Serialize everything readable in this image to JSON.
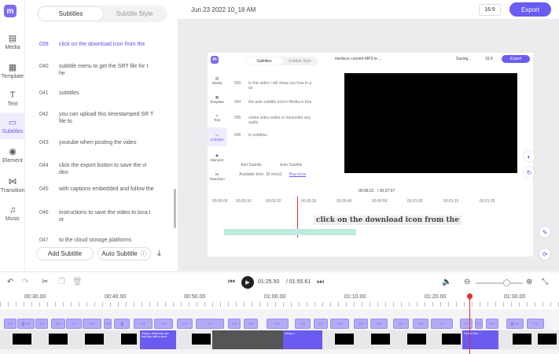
{
  "nav": {
    "items": [
      {
        "label": "Media",
        "icon": "folder-icon"
      },
      {
        "label": "Template",
        "icon": "grid-icon"
      },
      {
        "label": "Text",
        "icon": "text-icon"
      },
      {
        "label": "Subtitles",
        "icon": "subtitles-icon"
      },
      {
        "label": "Element",
        "icon": "element-icon"
      },
      {
        "label": "Transition",
        "icon": "transition-icon"
      },
      {
        "label": "Music",
        "icon": "music-icon"
      }
    ]
  },
  "subtitles_panel": {
    "tabs": [
      "Subtitles",
      "Subtitle Style"
    ],
    "rows": [
      {
        "num": "039",
        "text": "click on the download icon from the"
      },
      {
        "num": "040",
        "text": "subtitle menu to get the SRT file for t he"
      },
      {
        "num": "041",
        "text": "subtitles"
      },
      {
        "num": "042",
        "text": "you can upload this timestamped SR T file to"
      },
      {
        "num": "043",
        "text": "youtube when posting the video"
      },
      {
        "num": "044",
        "text": "click the export button to save the vi deo"
      },
      {
        "num": "045",
        "text": "with captions embedded and follow the"
      },
      {
        "num": "046",
        "text": "instructions to save the video to loca l or"
      },
      {
        "num": "047",
        "text": "to the cloud storage platforms"
      }
    ],
    "add_subtitle": "Add Subtitle",
    "auto_subtitle": "Auto Subtitle"
  },
  "topbar": {
    "title": "Jun 23 2022 10_18 AM",
    "ratio": "16:9",
    "export": "Export"
  },
  "inner": {
    "tabs": [
      "Subtitles",
      "Subtitle Style"
    ],
    "title": "media.io convert MP3 to ...",
    "saving": "Saving...",
    "ratio": "16:9",
    "export": "Export",
    "nav": [
      "Media",
      "Template",
      "Text",
      "Subtitles",
      "Element",
      "Transition"
    ],
    "rows": [
      {
        "num": "003",
        "text": "to this video i will show you how to p as"
      },
      {
        "num": "004",
        "text": "the auto subtitle tool in Media.io thre"
      },
      {
        "num": "005",
        "text": "online video editor to transcribe any audio"
      },
      {
        "num": "006",
        "text": "to subtitles"
      }
    ],
    "add_subtitle": "Add Subtitle",
    "auto_subtitle": "Auto Subtitle",
    "available": "Available time: 30 min(s)",
    "buy_more": "Buy more",
    "time_current": "00:06:21",
    "time_total": "/ 00:27:07",
    "ruler": [
      "00:00:00",
      "00:00:10",
      "00:00:20",
      "00:00:30",
      "00:00:40",
      "00:00:50",
      "00:01:00",
      "00:01:10",
      "00:01:20"
    ],
    "caption": "click on the download icon from the"
  },
  "timeline": {
    "time_current": "01:25.50",
    "time_total": "/ 01:55.61",
    "ruler": [
      "00:30.00",
      "00:40.00",
      "00:50.00",
      "01:00.00",
      "01:10.00",
      "01:20.00",
      "01:30.00"
    ],
    "clip_captions": [
      "Using a dictionary can help you with a word",
      "Using a ...",
      "Click a Sub ..."
    ]
  }
}
